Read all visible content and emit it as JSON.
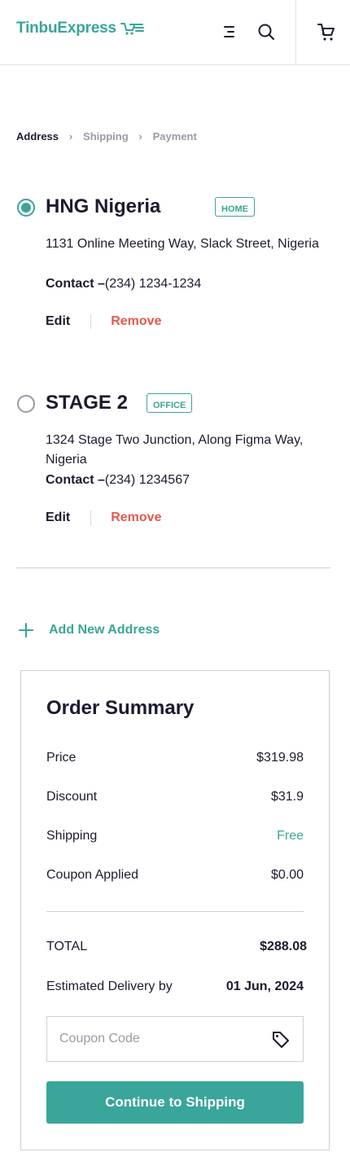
{
  "header": {
    "logo_text": "TinbuExpress",
    "brand_color": "#3aa59a",
    "icons": [
      "cart-speed-icon",
      "menu-icon",
      "search-icon",
      "cart-icon"
    ]
  },
  "breadcrumb": {
    "steps": [
      "Address",
      "Shipping",
      "Payment"
    ],
    "separator": "›",
    "active": "Address"
  },
  "addresses": [
    {
      "name": "HNG Nigeria",
      "tag": "HOME",
      "line": "1131 Online Meeting Way, Slack Street, Nigeria",
      "contact_label": "Contact –",
      "contact_value": "(234) 1234-1234",
      "selected": true,
      "edit_label": "Edit",
      "remove_label": "Remove"
    },
    {
      "name": "STAGE 2",
      "tag": "OFFICE",
      "line": "1324 Stage Two Junction, Along Figma Way, Nigeria",
      "contact_label": "Contact –",
      "contact_value": "(234) 1234567",
      "selected": false,
      "edit_label": "Edit",
      "remove_label": "Remove"
    }
  ],
  "add_new_label": "Add New Address",
  "summary": {
    "title": "Order Summary",
    "rows": [
      {
        "label": "Price",
        "value": "$319.98"
      },
      {
        "label": "Discount",
        "value": "$31.9"
      },
      {
        "label": "Shipping",
        "value": "Free"
      },
      {
        "label": "Coupon Applied",
        "value": "$0.00"
      }
    ],
    "total_label": "TOTAL",
    "total_value": "$288.08",
    "delivery_label": "Estimated Delivery by",
    "delivery_value": "01 Jun, 2024",
    "coupon_placeholder": "Coupon Code",
    "coupon_value": "",
    "continue_label": "Continue to Shipping"
  }
}
